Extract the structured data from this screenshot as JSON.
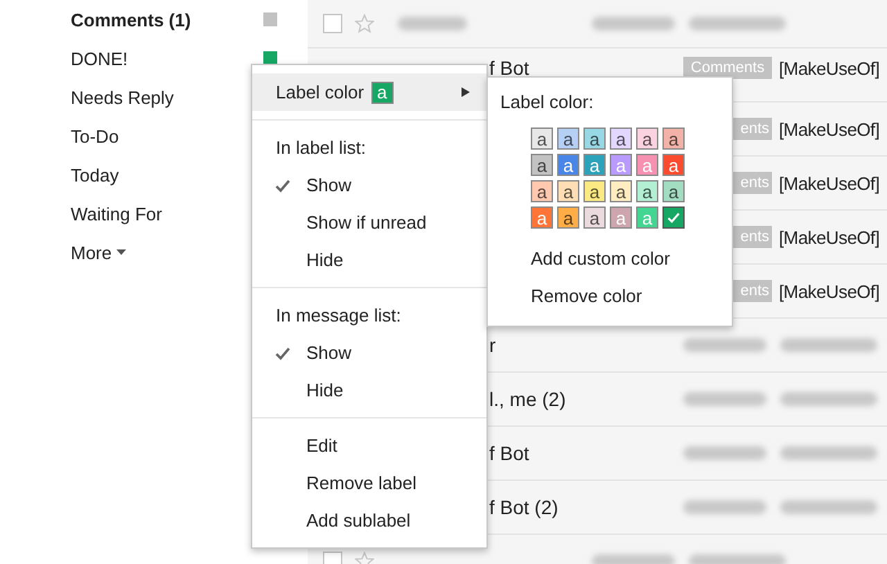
{
  "sidebar": {
    "labels": [
      {
        "name": "Comments (1)",
        "unread": true,
        "color": "#c2c2c2"
      },
      {
        "name": "DONE!",
        "unread": false,
        "color": "#16a765"
      },
      {
        "name": "Needs Reply",
        "unread": false
      },
      {
        "name": "To-Do",
        "unread": false
      },
      {
        "name": "Today",
        "unread": false
      },
      {
        "name": "Waiting For",
        "unread": false
      }
    ],
    "more": "More"
  },
  "messages": [
    {
      "kind": "full",
      "checked": false
    },
    {
      "kind": "covered",
      "sender": "f Bot",
      "tag": "Comments",
      "subject": "[MakeUseOf]"
    },
    {
      "kind": "covered",
      "tag": "ents",
      "subject": "[MakeUseOf]"
    },
    {
      "kind": "covered",
      "tag": "ents",
      "subject": "[MakeUseOf]"
    },
    {
      "kind": "covered",
      "tag": "ents",
      "subject": "[MakeUseOf]"
    },
    {
      "kind": "covered",
      "tag": "ents",
      "subject": "[MakeUseOf]"
    },
    {
      "kind": "covered",
      "sender": "r"
    },
    {
      "kind": "covered",
      "sender": "l., me (2)"
    },
    {
      "kind": "covered",
      "sender": "f Bot"
    },
    {
      "kind": "covered",
      "sender": "f Bot (2)"
    },
    {
      "kind": "full",
      "checked": false
    }
  ],
  "label_menu": {
    "items": [
      {
        "kind": "submenu",
        "label": "Label color",
        "swatch": "a",
        "color": "#16a765",
        "highlighted": true
      },
      {
        "kind": "divider"
      },
      {
        "kind": "header",
        "label": "In label list:"
      },
      {
        "kind": "option",
        "label": "Show",
        "checked": true
      },
      {
        "kind": "option",
        "label": "Show if unread",
        "checked": false
      },
      {
        "kind": "option",
        "label": "Hide",
        "checked": false
      },
      {
        "kind": "divider"
      },
      {
        "kind": "header",
        "label": "In message list:"
      },
      {
        "kind": "option",
        "label": "Show",
        "checked": true
      },
      {
        "kind": "option",
        "label": "Hide",
        "checked": false
      },
      {
        "kind": "divider"
      },
      {
        "kind": "action",
        "label": "Edit"
      },
      {
        "kind": "action",
        "label": "Remove label"
      },
      {
        "kind": "action",
        "label": "Add sublabel"
      }
    ]
  },
  "color_menu": {
    "title": "Label color:",
    "swatches": [
      {
        "text": "a",
        "color": "#e7e7e7",
        "selected": false
      },
      {
        "text": "a",
        "color": "#b6cff5",
        "selected": false
      },
      {
        "text": "a",
        "color": "#98d7e4",
        "selected": false
      },
      {
        "text": "a",
        "color": "#e3d7ff",
        "selected": false
      },
      {
        "text": "a",
        "color": "#fbd3e0",
        "selected": false
      },
      {
        "text": "a",
        "color": "#f2b2a8",
        "selected": false
      },
      {
        "text": "a",
        "color": "#c2c2c2",
        "selected": false
      },
      {
        "text": "a",
        "color": "#4986e7",
        "selected": false
      },
      {
        "text": "a",
        "color": "#2da2bb",
        "selected": false
      },
      {
        "text": "a",
        "color": "#b99aff",
        "selected": false
      },
      {
        "text": "a",
        "color": "#f691b2",
        "selected": false
      },
      {
        "text": "a",
        "color": "#fb4c2f",
        "selected": false
      },
      {
        "text": "a",
        "color": "#ffc8af",
        "selected": false
      },
      {
        "text": "a",
        "color": "#ffdeb5",
        "selected": false
      },
      {
        "text": "a",
        "color": "#fbe983",
        "selected": false
      },
      {
        "text": "a",
        "color": "#fdedc1",
        "selected": false
      },
      {
        "text": "a",
        "color": "#b3efd3",
        "selected": false
      },
      {
        "text": "a",
        "color": "#a2dcc1",
        "selected": false
      },
      {
        "text": "a",
        "color": "#ff7537",
        "selected": false
      },
      {
        "text": "a",
        "color": "#ffad46",
        "selected": false
      },
      {
        "text": "a",
        "color": "#ebdbde",
        "selected": false
      },
      {
        "text": "a",
        "color": "#cca6ac",
        "selected": false
      },
      {
        "text": "a",
        "color": "#42d692",
        "selected": false
      },
      {
        "color": "#16a765",
        "selected": true
      }
    ],
    "actions": [
      "Add custom color",
      "Remove color"
    ]
  }
}
